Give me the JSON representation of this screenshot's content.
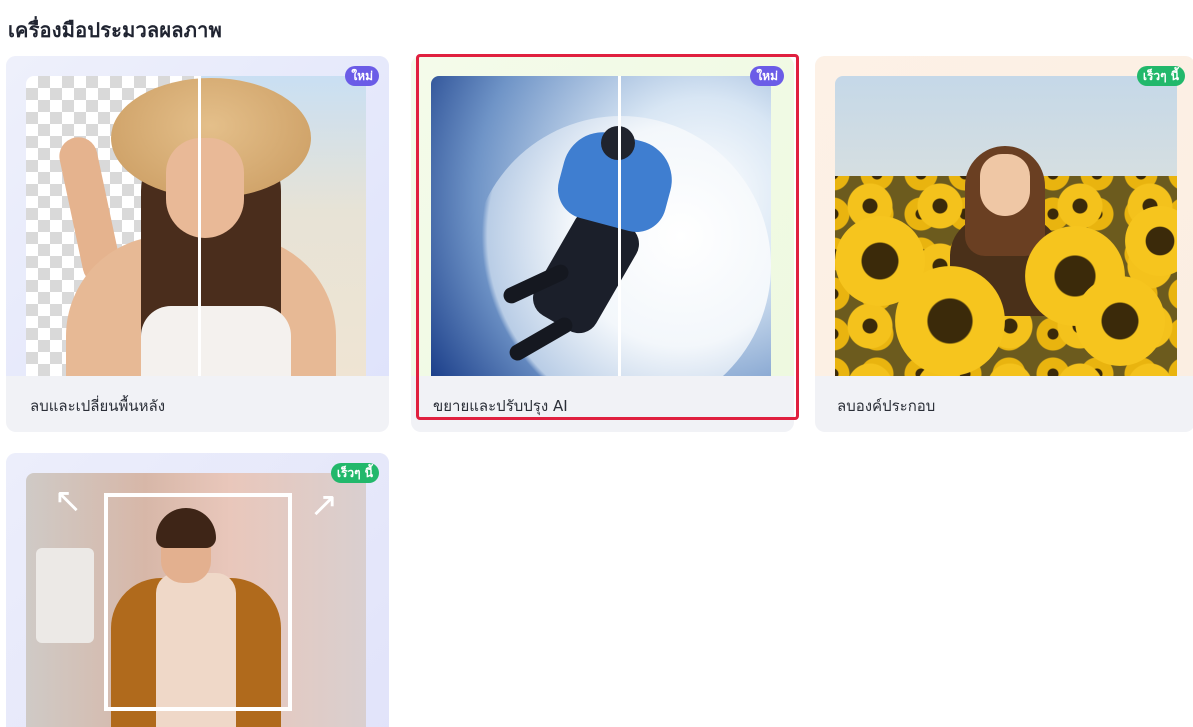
{
  "section": {
    "title": "เครื่องมือประมวลผลภาพ"
  },
  "cards": [
    {
      "label": "ลบและเปลี่ยนพื้นหลัง",
      "badge": "ใหม่",
      "badge_color": "#6b5ce7"
    },
    {
      "label": "ขยายและปรับปรุง AI",
      "badge": "ใหม่",
      "badge_color": "#6b5ce7",
      "highlighted": true,
      "highlight_color": "#e0203f"
    },
    {
      "label": "ลบองค์ประกอบ",
      "badge": "เร็วๆ นี้",
      "badge_color": "#22b86b"
    },
    {
      "label": "",
      "badge": "เร็วๆ นี้",
      "badge_color": "#22b86b"
    }
  ],
  "icons": {
    "expand_arrows": [
      "arrow-up-left-icon",
      "arrow-up-right-icon"
    ]
  }
}
